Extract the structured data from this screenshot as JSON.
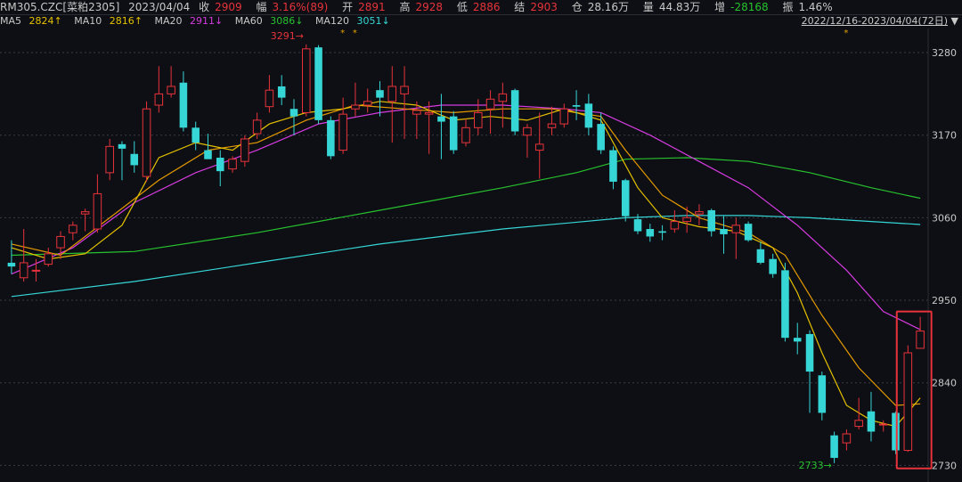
{
  "header": {
    "symbol": "RM305.CZC[菜粕2305]",
    "date": "2023/04/04",
    "close_label": "收",
    "close": "2909",
    "amp_label": "幅",
    "amp": "3.16%(89)",
    "open_label": "开",
    "open": "2891",
    "high_label": "高",
    "high": "2928",
    "low_label": "低",
    "low": "2886",
    "settle_label": "结",
    "settle": "2903",
    "oi_label": "仓",
    "oi": "28.16万",
    "vol_label": "量",
    "vol": "44.83万",
    "inc_label": "增",
    "inc": "-28168",
    "swing_label": "振",
    "swing": "1.46%"
  },
  "ma_legend": [
    {
      "label": "MA5",
      "value": "2824↑",
      "color": "#e5c100"
    },
    {
      "label": "MA10",
      "value": "2816↑",
      "color": "#e5c100"
    },
    {
      "label": "MA20",
      "value": "2911↓",
      "color": "#d63be0"
    },
    {
      "label": "MA60",
      "value": "3086↓",
      "color": "#28c22e"
    },
    {
      "label": "MA120",
      "value": "3051↓",
      "color": "#36d6d6"
    }
  ],
  "range": {
    "text": "2022/12/16-2023/04/04(72日)",
    "arrow": "▼"
  },
  "colors": {
    "up": "#e8333b",
    "down": "#36d6d6",
    "ma5": "#e5c100",
    "ma10": "#e59a00",
    "ma20": "#d63be0",
    "ma60": "#28c22e",
    "ma120": "#36d6d6",
    "grid": "#3a3d44"
  },
  "chart_data": {
    "type": "candlestick",
    "ylim": [
      2715,
      3305
    ],
    "yticks": [
      2730,
      2840,
      2950,
      3060,
      3170,
      3280
    ],
    "annotations": {
      "high": "3291",
      "low": "2733"
    },
    "stars": [
      27,
      28,
      68
    ],
    "candles": [
      [
        3000,
        2995,
        3030,
        2985
      ],
      [
        2980,
        3000,
        3045,
        2975
      ],
      [
        2990,
        2990,
        3005,
        2975
      ],
      [
        2998,
        3012,
        3020,
        2995
      ],
      [
        3020,
        3035,
        3042,
        3005
      ],
      [
        3040,
        3050,
        3055,
        3030
      ],
      [
        3065,
        3068,
        3072,
        3042
      ],
      [
        3045,
        3092,
        3118,
        3040
      ],
      [
        3120,
        3155,
        3165,
        3110
      ],
      [
        3158,
        3152,
        3162,
        3110
      ],
      [
        3145,
        3130,
        3162,
        3120
      ],
      [
        3115,
        3205,
        3215,
        3108
      ],
      [
        3210,
        3225,
        3262,
        3200
      ],
      [
        3225,
        3235,
        3262,
        3220
      ],
      [
        3240,
        3180,
        3255,
        3175
      ],
      [
        3180,
        3160,
        3188,
        3150
      ],
      [
        3150,
        3138,
        3172,
        3140
      ],
      [
        3140,
        3122,
        3150,
        3102
      ],
      [
        3125,
        3138,
        3142,
        3120
      ],
      [
        3135,
        3165,
        3170,
        3128
      ],
      [
        3172,
        3190,
        3200,
        3165
      ],
      [
        3208,
        3230,
        3250,
        3200
      ],
      [
        3235,
        3220,
        3250,
        3210
      ],
      [
        3205,
        3195,
        3218,
        3170
      ],
      [
        3200,
        3285,
        3291,
        3195
      ],
      [
        3287,
        3190,
        3290,
        3185
      ],
      [
        3190,
        3142,
        3195,
        3138
      ],
      [
        3150,
        3198,
        3220,
        3145
      ],
      [
        3205,
        3210,
        3240,
        3195
      ],
      [
        3210,
        3215,
        3232,
        3200
      ],
      [
        3230,
        3220,
        3242,
        3195
      ],
      [
        3215,
        3235,
        3262,
        3160
      ],
      [
        3225,
        3235,
        3262,
        3165
      ],
      [
        3198,
        3203,
        3215,
        3165
      ],
      [
        3198,
        3200,
        3215,
        3145
      ],
      [
        3195,
        3188,
        3225,
        3138
      ],
      [
        3195,
        3150,
        3202,
        3145
      ],
      [
        3160,
        3180,
        3192,
        3155
      ],
      [
        3180,
        3200,
        3218,
        3170
      ],
      [
        3205,
        3218,
        3230,
        3172
      ],
      [
        3215,
        3225,
        3240,
        3180
      ],
      [
        3230,
        3175,
        3232,
        3170
      ],
      [
        3170,
        3180,
        3185,
        3140
      ],
      [
        3150,
        3158,
        3200,
        3112
      ],
      [
        3180,
        3185,
        3208,
        3170
      ],
      [
        3185,
        3205,
        3212,
        3180
      ],
      [
        3210,
        3208,
        3230,
        3190
      ],
      [
        3212,
        3180,
        3225,
        3170
      ],
      [
        3185,
        3150,
        3200,
        3145
      ],
      [
        3150,
        3108,
        3155,
        3098
      ],
      [
        3110,
        3062,
        3112,
        3055
      ],
      [
        3058,
        3042,
        3065,
        3038
      ],
      [
        3045,
        3035,
        3052,
        3028
      ],
      [
        3042,
        3040,
        3050,
        3030
      ],
      [
        3045,
        3055,
        3070,
        3040
      ],
      [
        3055,
        3060,
        3075,
        3040
      ],
      [
        3065,
        3068,
        3078,
        3050
      ],
      [
        3070,
        3042,
        3072,
        3035
      ],
      [
        3045,
        3038,
        3062,
        3012
      ],
      [
        3040,
        3050,
        3060,
        3005
      ],
      [
        3052,
        3030,
        3055,
        3028
      ],
      [
        3018,
        3000,
        3028,
        2998
      ],
      [
        3005,
        2985,
        3012,
        2980
      ],
      [
        2990,
        2900,
        3000,
        2895
      ],
      [
        2900,
        2895,
        2920,
        2878
      ],
      [
        2905,
        2855,
        2910,
        2800
      ],
      [
        2850,
        2800,
        2855,
        2790
      ],
      [
        2770,
        2740,
        2775,
        2733
      ],
      [
        2760,
        2772,
        2778,
        2750
      ],
      [
        2782,
        2790,
        2820,
        2778
      ],
      [
        2802,
        2775,
        2828,
        2762
      ],
      [
        2785,
        2785,
        2790,
        2775
      ],
      [
        2800,
        2750,
        2802,
        2745
      ],
      [
        2750,
        2880,
        2890,
        2748
      ],
      [
        2886,
        2909,
        2928,
        2886
      ]
    ],
    "ma5": [
      [
        0,
        3020
      ],
      [
        3,
        3005
      ],
      [
        6,
        3012
      ],
      [
        9,
        3050
      ],
      [
        12,
        3140
      ],
      [
        15,
        3160
      ],
      [
        18,
        3150
      ],
      [
        21,
        3185
      ],
      [
        24,
        3200
      ],
      [
        27,
        3205
      ],
      [
        30,
        3215
      ],
      [
        33,
        3210
      ],
      [
        36,
        3190
      ],
      [
        39,
        3195
      ],
      [
        42,
        3190
      ],
      [
        45,
        3205
      ],
      [
        48,
        3190
      ],
      [
        51,
        3100
      ],
      [
        53,
        3060
      ],
      [
        56,
        3048
      ],
      [
        59,
        3042
      ],
      [
        62,
        3020
      ],
      [
        64,
        2960
      ],
      [
        66,
        2880
      ],
      [
        68,
        2810
      ],
      [
        70,
        2790
      ],
      [
        72,
        2782
      ],
      [
        74,
        2820
      ]
    ],
    "ma10": [
      [
        0,
        3025
      ],
      [
        4,
        3010
      ],
      [
        8,
        3060
      ],
      [
        12,
        3110
      ],
      [
        16,
        3150
      ],
      [
        20,
        3160
      ],
      [
        24,
        3190
      ],
      [
        28,
        3210
      ],
      [
        32,
        3205
      ],
      [
        36,
        3200
      ],
      [
        40,
        3205
      ],
      [
        44,
        3205
      ],
      [
        48,
        3195
      ],
      [
        50,
        3150
      ],
      [
        53,
        3090
      ],
      [
        56,
        3060
      ],
      [
        60,
        3040
      ],
      [
        63,
        3010
      ],
      [
        66,
        2930
      ],
      [
        69,
        2860
      ],
      [
        72,
        2810
      ],
      [
        74,
        2812
      ]
    ],
    "ma20": [
      [
        0,
        2985
      ],
      [
        5,
        3020
      ],
      [
        10,
        3080
      ],
      [
        15,
        3120
      ],
      [
        20,
        3150
      ],
      [
        25,
        3185
      ],
      [
        30,
        3200
      ],
      [
        35,
        3210
      ],
      [
        40,
        3210
      ],
      [
        45,
        3205
      ],
      [
        48,
        3200
      ],
      [
        52,
        3170
      ],
      [
        56,
        3135
      ],
      [
        60,
        3100
      ],
      [
        64,
        3050
      ],
      [
        68,
        2990
      ],
      [
        71,
        2935
      ],
      [
        74,
        2911
      ]
    ],
    "ma60": [
      [
        0,
        3010
      ],
      [
        10,
        3015
      ],
      [
        20,
        3040
      ],
      [
        30,
        3070
      ],
      [
        40,
        3100
      ],
      [
        46,
        3120
      ],
      [
        50,
        3138
      ],
      [
        55,
        3140
      ],
      [
        60,
        3135
      ],
      [
        65,
        3120
      ],
      [
        70,
        3100
      ],
      [
        74,
        3086
      ]
    ],
    "ma120": [
      [
        0,
        2955
      ],
      [
        10,
        2975
      ],
      [
        20,
        3000
      ],
      [
        30,
        3025
      ],
      [
        40,
        3045
      ],
      [
        50,
        3060
      ],
      [
        55,
        3063
      ],
      [
        60,
        3063
      ],
      [
        65,
        3060
      ],
      [
        70,
        3055
      ],
      [
        74,
        3051
      ]
    ]
  }
}
